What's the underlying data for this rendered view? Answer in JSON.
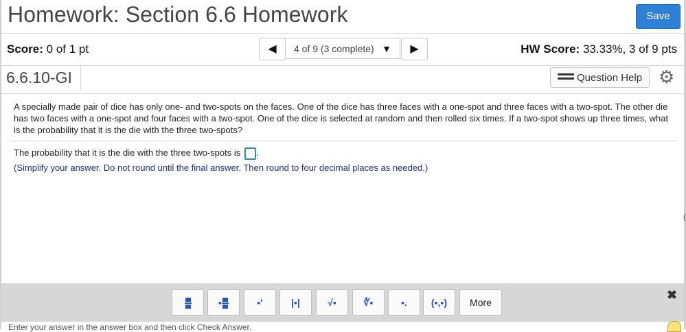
{
  "header": {
    "title": "Homework: Section 6.6 Homework",
    "save_label": "Save"
  },
  "status": {
    "score_label": "Score:",
    "score_value": "0 of 1 pt",
    "nav_prev_glyph": "◀",
    "nav_next_glyph": "▶",
    "nav_position": "4 of 9 (3 complete)",
    "nav_caret_glyph": "▼",
    "hw_score_label": "HW Score:",
    "hw_score_value": "33.33%, 3 of 9 pts"
  },
  "question_header": {
    "id": "6.6.10-GI",
    "help_label": "Question Help",
    "help_icon": "list-icon",
    "settings_icon": "gear-icon"
  },
  "question": {
    "text": "A specially made pair of dice has only one- and two-spots on the faces. One of the dice has three faces with a one-spot and three faces with a two-spot. The other die has two faces with a one-spot and four faces with a two-spot. One of the dice is selected at random and then rolled six times. If a two-spot shows up three times, what is the probability that it is the die with the three two-spots?",
    "prompt": "The probability that it is the die with the three two-spots is",
    "answer_value": "",
    "prompt_suffix": ".",
    "hint": "(Simplify your answer. Do not round until the final answer. Then round to four decimal places as needed.)"
  },
  "math_toolbar": {
    "buttons": [
      {
        "name": "fraction-icon",
        "glyph": ""
      },
      {
        "name": "mixed-number-icon",
        "glyph": ""
      },
      {
        "name": "exponent-icon",
        "glyph": "▪'"
      },
      {
        "name": "absolute-value-icon",
        "glyph": "|▪|"
      },
      {
        "name": "square-root-icon",
        "glyph": "√▪"
      },
      {
        "name": "nth-root-icon",
        "glyph": "∜▪"
      },
      {
        "name": "decimal-icon",
        "glyph": "▪."
      },
      {
        "name": "interval-icon",
        "glyph": "(▪,▪)"
      }
    ],
    "more_label": "More",
    "close_glyph": "✖"
  },
  "footer": {
    "instruction": "Enter your answer in the answer box and then click Check Answer."
  },
  "colors": {
    "accent": "#2e7fd6",
    "hint_text": "#1a2d8c",
    "toolbar_bg": "#d7d7d7",
    "answer_box_border": "#2b8fb7"
  }
}
